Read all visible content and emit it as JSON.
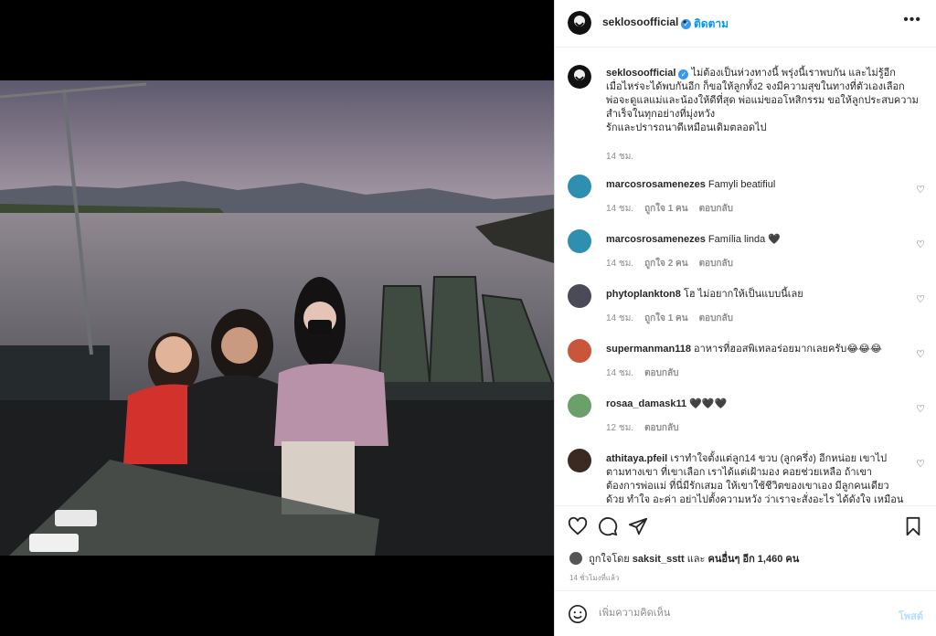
{
  "post": {
    "username": "seklosoofficial",
    "dot": "•",
    "follow_label": "ติดตาม",
    "more_label": "•••"
  },
  "caption": {
    "username": "seklosoofficial",
    "lines": [
      "ไม่ต้องเป็นห่วงทางนี้ พรุ่งนี้เราพบกัน และไม่รู้อีก",
      "เมื่อไหร่จะได้พบกันอีก ก็ขอให้ลูกทั้ง2 จงมีความสุขในทางที่ตัวเองเลือก",
      "พ่อจะดูแลแม่และน้องให้ดีที่สุด พ่อแม่ขออโหสิกรรม ขอให้ลูกประสบความ",
      "สำเร็จในทุกอย่างที่มุ่งหวัง",
      "รักและปรารถนาดีเหมือนเดิมตลอดไป"
    ],
    "time": "14 ชม."
  },
  "comments": [
    {
      "username": "marcosrosamenezes",
      "text": "Famyli beatifiul",
      "time": "14 ชม.",
      "likes": "ถูกใจ 1 คน",
      "reply": "ตอบกลับ",
      "avatar_color": "#2f8fb0"
    },
    {
      "username": "marcosrosamenezes",
      "text": "Família linda 🖤",
      "time": "14 ชม.",
      "likes": "ถูกใจ 2 คน",
      "reply": "ตอบกลับ",
      "avatar_color": "#2f8fb0"
    },
    {
      "username": "phytoplankton8",
      "text": "โฮ ไม่อยากให้เป็นแบบนี้เลย",
      "time": "14 ชม.",
      "likes": "ถูกใจ 1 คน",
      "reply": "ตอบกลับ",
      "avatar_color": "#4a4a58"
    },
    {
      "username": "supermanman118",
      "text": "อาหารที่ฮอสพิเทลอร่อยมากเลยครับ😂😂😂",
      "time": "14 ชม.",
      "likes": "",
      "reply": "ตอบกลับ",
      "avatar_color": "#c9553a"
    },
    {
      "username": "rosaa_damask11",
      "text": "🖤🖤🖤",
      "time": "12 ชม.",
      "likes": "",
      "reply": "ตอบกลับ",
      "avatar_color": "#6aa06a"
    },
    {
      "username": "athitaya.pfeil",
      "text": "เราทำใจตั้งแต่ลูก14 ขวบ (ลูกครึ่ง) อีกหน่อย เขาไป ตามทางเขา ที่เขาเลือก เราได้แต่เฝ้ามอง คอยช่วยเหลือ ถ้าเขา ต้องการพ่อแม่ ที่นี่มีรักเสมอ ให้เขาใช้ชีวิตของเขาเอง มีลูกคนเดียว ด้วย ทำใจ อะค่า อย่าไปตั้งความหวัง ว่าเราจะสั่งอะไร ได้ดังใจ เหมือน",
      "time": "",
      "likes": "",
      "reply": "",
      "avatar_color": "#3a2a22"
    }
  ],
  "likes_summary": {
    "prefix": "ถูกใจโดย",
    "user": "saksit_sstt",
    "and": "และ",
    "others": "คนอื่นๆ อีก 1,460 คน"
  },
  "post_time": "14 ชั่วโมงที่แล้ว",
  "add_comment": {
    "placeholder": "เพิ่มความคิดเห็น",
    "post_label": "โพสต์"
  },
  "icons": {
    "like": "heart-icon",
    "comment": "comment-icon",
    "share": "send-icon",
    "save": "bookmark-icon",
    "emoji": "emoji-icon"
  },
  "colors": {
    "accent": "#0095f6",
    "verified": "#3897f0"
  }
}
